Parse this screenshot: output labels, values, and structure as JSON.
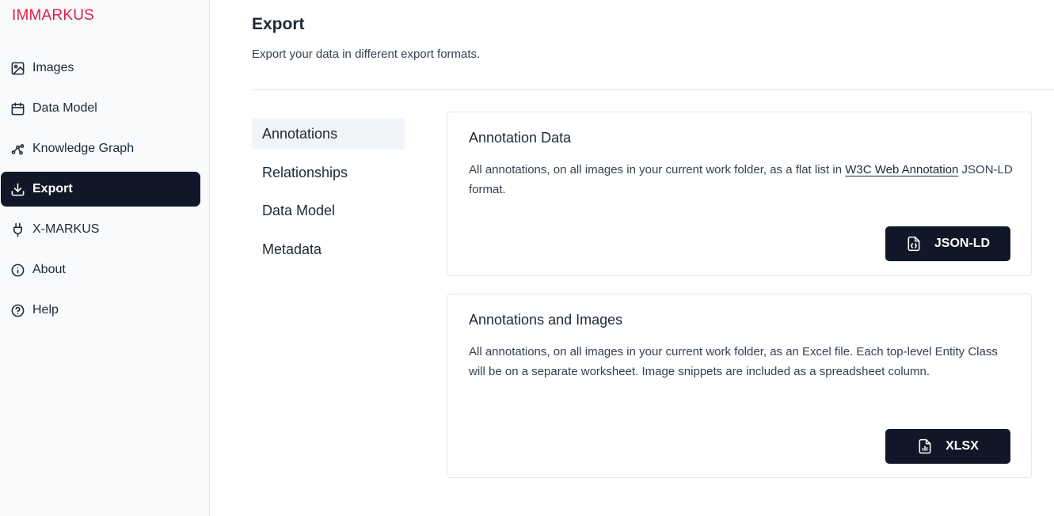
{
  "app": {
    "brand": "IMMARKUS",
    "brand_color": "#e11d48",
    "active_color": "#101828"
  },
  "sidebar": {
    "items": [
      {
        "label": "Images",
        "icon": "image-icon"
      },
      {
        "label": "Data Model",
        "icon": "calendar-icon"
      },
      {
        "label": "Knowledge Graph",
        "icon": "graph-icon"
      },
      {
        "label": "Export",
        "icon": "download-icon",
        "active": true
      },
      {
        "label": "X-MARKUS",
        "icon": "plug-icon"
      },
      {
        "label": "About",
        "icon": "info-icon"
      },
      {
        "label": "Help",
        "icon": "help-icon"
      }
    ]
  },
  "page": {
    "title": "Export",
    "subtitle": "Export your data in different export formats."
  },
  "subnav": {
    "items": [
      {
        "label": "Annotations",
        "active": true
      },
      {
        "label": "Relationships"
      },
      {
        "label": "Data Model"
      },
      {
        "label": "Metadata"
      }
    ]
  },
  "cards": [
    {
      "title": "Annotation Data",
      "text_before": "All annotations, on all images in your current work folder, as a flat list in ",
      "link": "W3C Web Annotation",
      "text_after": " JSON-LD format.",
      "button_label": "JSON-LD",
      "button_icon": "file-json-icon"
    },
    {
      "title": "Annotations and Images",
      "text": "All annotations, on all images in your current work folder, as an Excel file. Each top-level Entity Class will be on a separate worksheet. Image snippets are included as a spreadsheet column.",
      "button_label": "XLSX",
      "button_icon": "file-spreadsheet-icon"
    }
  ]
}
